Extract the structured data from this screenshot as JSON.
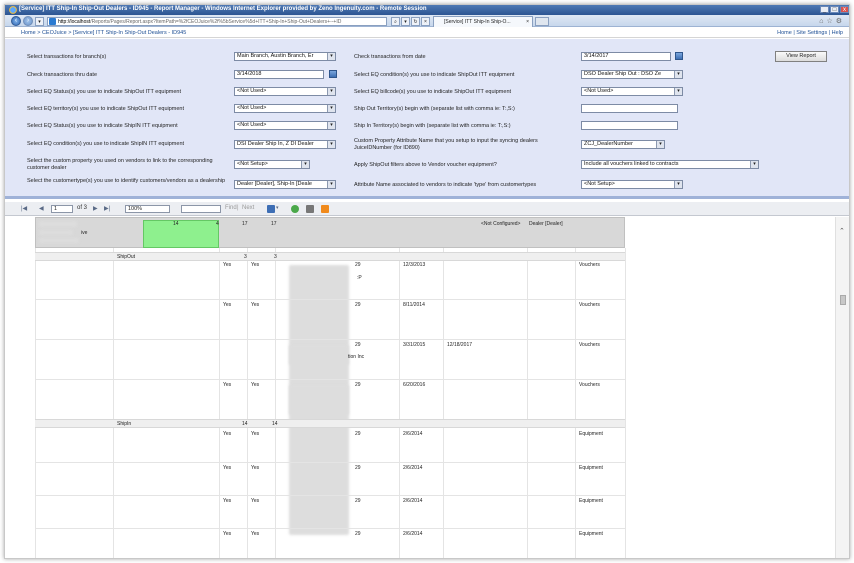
{
  "window": {
    "title": "[Service] ITT Ship-In Ship-Out Dealers - ID945 - Report Manager - Windows Internet Explorer provided by Zeno Ingenuity.com - Remote Session",
    "address_host": "http://localhost",
    "address_path": "/Reports/Pages/Report.aspx?ItemPath=%2fCEOJuice%2f%5bService%5d+ITT+Ship-In+Ship-Out+Dealers+--+ID",
    "tab_label": "[Service] ITT Ship-In Ship-O...",
    "controls": [
      "_",
      "□",
      "x"
    ]
  },
  "breadcrumb": "Home > CEOJuice > [Service] ITT Ship-In Ship-Out Dealers - ID945",
  "top_links": "Home | Site Settings | Help",
  "view_report_label": "View Report",
  "params": {
    "branch": {
      "label": "Select transactions for branch(s)",
      "value": "Main Branch, Austin Branch, Er"
    },
    "from_date": {
      "label": "Check transactions from date",
      "value": "3/14/2017"
    },
    "thru_date": {
      "label": "Check transactions thru date",
      "value": "3/14/2018"
    },
    "eq_cond_out": {
      "label": "Select EQ condition(s) you use to indicate ShipOut ITT equipment",
      "value": "DSO Dealer Ship Out : DSO Ze"
    },
    "eq_status_out": {
      "label": "Select EQ Status(s) you use to indicate ShipOut ITT equipment",
      "value": "<Not Used>"
    },
    "billcode_out": {
      "label": "Select EQ billcode(s) you use to indicate ShipOut ITT equipment",
      "value": "<Not Used>"
    },
    "territory_out": {
      "label": "Select EQ territory(s) you use to indicate ShipOut ITT equipment",
      "value": "<Not Used>"
    },
    "shipout_territory": {
      "label": "Ship Out Territory(s) begin with (separate list with comma ie: T:,S:)",
      "value": ""
    },
    "eq_status_in": {
      "label": "Select EQ Status(s) you use to indicate ShipIN ITT equipment",
      "value": "<Not Used>"
    },
    "shipin_territory": {
      "label": "Ship In Territory(s) begin with (separate list with comma ie: T:,S:)",
      "value": ""
    },
    "eq_cond_in": {
      "label": "Select EQ condition(s) you use to indicate ShipIN ITT equipment",
      "value": "DSI Dealer Ship In, Z DI Dealer"
    },
    "custom_attr": {
      "label": "Custom Property Attribute Name that you setup to input the syncing dealers JuiceIDNumber (for ID890)",
      "value": "ZCJ_DealerNumber"
    },
    "vendor_prop": {
      "label": "Select the custom property you used on vendors to link to the corresponding customer dealer",
      "value": "<Not Setup>"
    },
    "apply_filters": {
      "label": "Apply ShipOut filters above to Vendor voucher equipment?",
      "value": "Include all vouchers linked to contracts"
    },
    "customertype": {
      "label": "Select the customertype(s) you use to identify customers/vendors as a dealership",
      "value": "Dealer [Dealer], Ship-In [Deale"
    },
    "attr_type": {
      "label": "Attribute Name associated to vendors to indicate 'type' from customertypes",
      "value": "<Not Setup>"
    }
  },
  "toolbar": {
    "page": "1",
    "of_pages": "of 3",
    "zoom": "100%",
    "find": "Find",
    "next": "Next"
  },
  "report": {
    "header": {
      "n1": "14",
      "n2": "4",
      "n3": "17",
      "n4": "17",
      "not_configured": "<Not Configured>",
      "dealer": "Dealer [Dealer]",
      "frag1": "ive"
    },
    "shipout": {
      "label": "ShipOut",
      "n1": "3",
      "n2": "3"
    },
    "shipin": {
      "label": "ShipIn",
      "n1": "14",
      "n2": "14"
    },
    "shipout_rows": [
      {
        "yes1": "Yes",
        "yes2": "Yes",
        "code": "29",
        "date": "12/3/2013",
        "date2": "",
        "type": "Vouchers"
      },
      {
        "yes1": "Yes",
        "yes2": "Yes",
        "code": "29",
        "date": "8/11/2014",
        "date2": "",
        "type": "Vouchers"
      },
      {
        "yes1": "",
        "yes2": "",
        "code": "29",
        "date": "3/31/2015",
        "date2": "12/18/2017",
        "type": "Vouchers"
      },
      {
        "yes1": "Yes",
        "yes2": "Yes",
        "code": "29",
        "date": "6/20/2016",
        "date2": "",
        "type": "Vouchers"
      }
    ],
    "shipout_extra": ":P",
    "shipout_extra2": "tion Inc",
    "shipin_rows": [
      {
        "yes1": "Yes",
        "yes2": "Yes",
        "code": "29",
        "date": "2/6/2014",
        "type": "Equipment"
      },
      {
        "yes1": "Yes",
        "yes2": "Yes",
        "code": "29",
        "date": "2/6/2014",
        "type": "Equipment"
      },
      {
        "yes1": "Yes",
        "yes2": "Yes",
        "code": "29",
        "date": "2/6/2014",
        "type": "Equipment"
      },
      {
        "yes1": "Yes",
        "yes2": "Yes",
        "code": "29",
        "date": "2/6/2014",
        "type": "Equipment"
      }
    ]
  }
}
